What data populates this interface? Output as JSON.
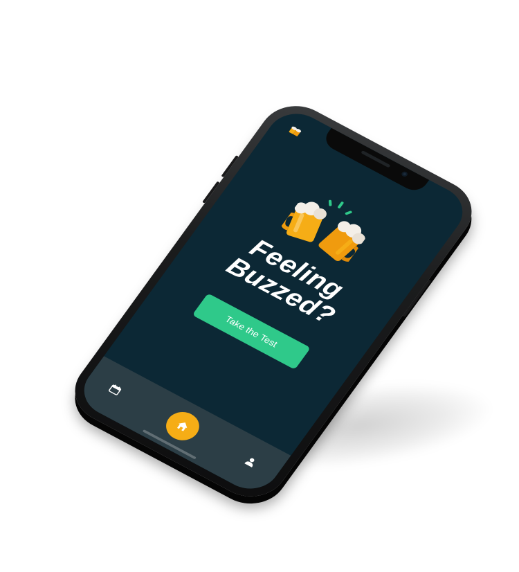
{
  "app": {
    "headline_line1": "Feeling",
    "headline_line2": "Buzzed?",
    "cta_label": "Take the Test"
  },
  "icons": {
    "corner": "beer-mugs-icon",
    "hero": "beer-mugs-cheers-icon",
    "tab_left": "calendar-icon",
    "tab_center": "home-icon",
    "tab_right": "profile-icon"
  },
  "colors": {
    "screen_bg": "#0c2835",
    "tabbar_bg": "#2c3e46",
    "accent_green": "#2fc98a",
    "accent_orange": "#f6ad16",
    "foam": "#f4efe8"
  }
}
